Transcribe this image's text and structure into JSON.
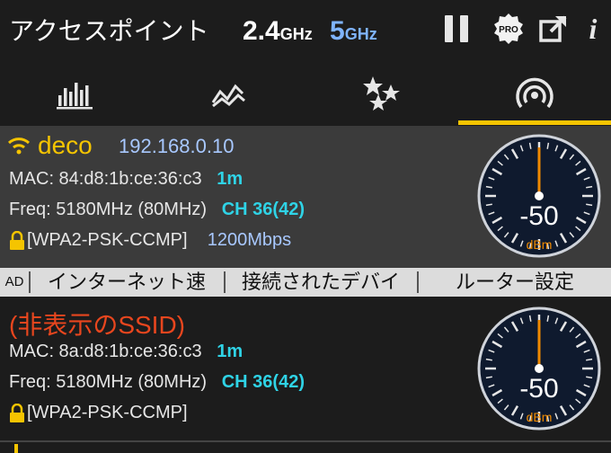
{
  "header": {
    "title": "アクセスポイント",
    "band24": {
      "value": "2.4",
      "unit": "GHz"
    },
    "band5": {
      "value": "5",
      "unit": "GHz"
    },
    "icons": [
      "pause-icon",
      "pro-badge-icon",
      "share-icon",
      "info-icon"
    ],
    "pro_label": "PRO",
    "info_label": "i"
  },
  "tabs": [
    {
      "name": "channel-graph",
      "icon": "bar-graph-icon"
    },
    {
      "name": "time-graph",
      "icon": "time-graph-icon"
    },
    {
      "name": "channel-rating",
      "icon": "stars-icon"
    },
    {
      "name": "access-points",
      "icon": "signal-icon",
      "selected": true
    }
  ],
  "networks": [
    {
      "ssid": "deco",
      "ip": "192.168.0.10",
      "mac": "MAC: 84:d8:1b:ce:36:c3",
      "distance": "1m",
      "freq": "Freq: 5180MHz  (80MHz)",
      "channel": "CH 36(42)",
      "security": "[WPA2-PSK-CCMP]",
      "rate": "1200Mbps",
      "signal": "-50",
      "signal_unit": "dBm"
    },
    {
      "ssid": "(非表示のSSID)",
      "mac": "MAC: 8a:d8:1b:ce:36:c3",
      "distance": "1m",
      "freq": "Freq: 5180MHz  (80MHz)",
      "channel": "CH 36(42)",
      "security": "[WPA2-PSK-CCMP]",
      "signal": "-50",
      "signal_unit": "dBm"
    }
  ],
  "actions": {
    "ad": "AD",
    "speed": "インターネット速",
    "devices": "接続されたデバイ",
    "router": "ルーター設定"
  },
  "colors": {
    "accent": "#f5c400",
    "hidden_ssid": "#e8461e",
    "channel": "#2fd3e6",
    "band5": "#7fb4ff",
    "gauge_needle": "#f08a00"
  }
}
